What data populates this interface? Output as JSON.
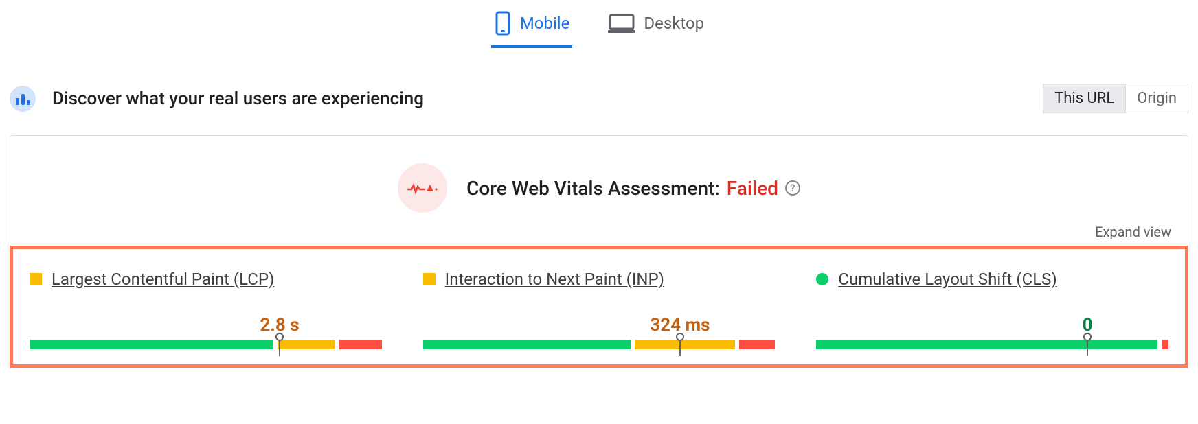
{
  "tabs": {
    "mobile": "Mobile",
    "desktop": "Desktop",
    "active": "mobile"
  },
  "header": {
    "title": "Discover what your real users are experiencing",
    "scope": {
      "this_url": "This URL",
      "origin": "Origin",
      "active": "this_url"
    }
  },
  "assessment": {
    "label": "Core Web Vitals Assessment:",
    "status_text": "Failed",
    "status_color": "#d93025",
    "expand": "Expand view"
  },
  "metrics": [
    {
      "id": "lcp",
      "name": "Largest Contentful Paint (LCP)",
      "indicator_shape": "square",
      "indicator_color": "orange",
      "value": "2.8 s",
      "value_color": "orange",
      "marker_pct": 71,
      "segments": [
        {
          "color": "g",
          "pct": 68
        },
        {
          "color": "o",
          "pct": 16
        },
        {
          "color": "r",
          "pct": 12
        }
      ]
    },
    {
      "id": "inp",
      "name": "Interaction to Next Paint (INP)",
      "indicator_shape": "square",
      "indicator_color": "orange",
      "value": "324 ms",
      "value_color": "orange",
      "marker_pct": 73,
      "segments": [
        {
          "color": "g",
          "pct": 58
        },
        {
          "color": "o",
          "pct": 28
        },
        {
          "color": "r",
          "pct": 10
        }
      ]
    },
    {
      "id": "cls",
      "name": "Cumulative Layout Shift (CLS)",
      "indicator_shape": "circle",
      "indicator_color": "green",
      "value": "0",
      "value_color": "green",
      "marker_pct": 77,
      "segments": [
        {
          "color": "g",
          "pct": 96
        },
        {
          "color": "r",
          "pct": 2
        }
      ]
    }
  ]
}
